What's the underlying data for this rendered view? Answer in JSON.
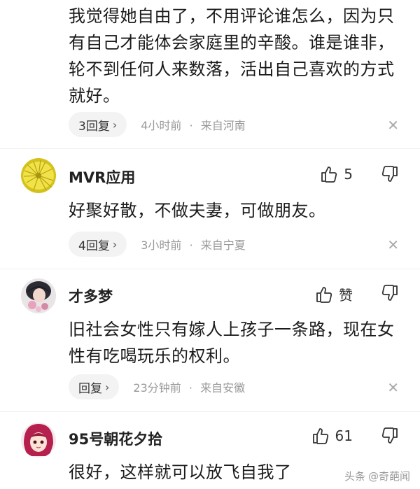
{
  "comments": [
    {
      "text": "我觉得她自由了，不用评论谁怎么，因为只有自己才能体会家庭里的辛酸。谁是谁非，轮不到任何人来数落，活出自己喜欢的方式就好。",
      "reply_label": "3回复",
      "time": "4小时前",
      "location": "来自河南"
    },
    {
      "name": "MVR应用",
      "likes": "5",
      "text": "好聚好散，不做夫妻，可做朋友。",
      "reply_label": "4回复",
      "time": "3小时前",
      "location": "来自宁夏"
    },
    {
      "name": "才多梦",
      "likes": "赞",
      "text": "旧社会女性只有嫁人上孩子一条路，现在女性有吃喝玩乐的权利。",
      "reply_label": "回复",
      "time": "23分钟前",
      "location": "来自安徽"
    },
    {
      "name": "95号朝花夕拾",
      "likes": "61",
      "text": "很好，这样就可以放飞自我了"
    }
  ],
  "separator": "·",
  "chevron": "›",
  "close_glyph": "✕",
  "watermark": {
    "prefix": "头条",
    "account": "@奇葩闻"
  }
}
